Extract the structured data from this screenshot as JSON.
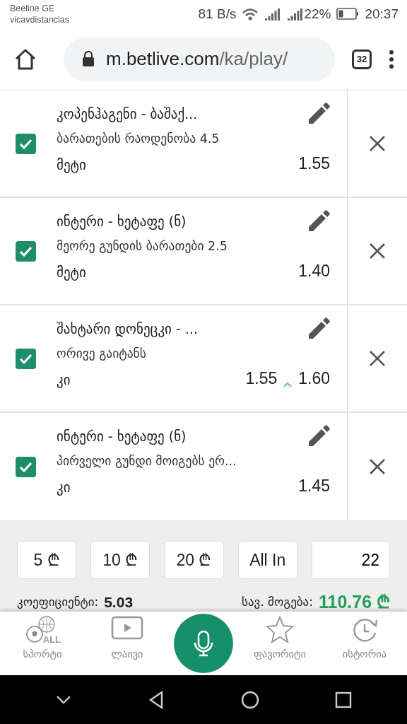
{
  "status_bar": {
    "carrier": "Beeline GE",
    "network_name": "vicavdistancias",
    "speed": "81 B/s",
    "battery": "22%",
    "time": "20:37"
  },
  "browser": {
    "url_host": "m.betlive.com",
    "url_path": "/ka/play/",
    "tab_count": "32"
  },
  "bets": [
    {
      "match": "კოპენჰაგენი - ბაშაქ...",
      "market": "ბარათების რაოდენობა 4.5",
      "selection": "მეტი",
      "odds": "1.55",
      "checked": true
    },
    {
      "match": "ინტერი - ხეტაფე (ნ)",
      "market": "მეორე გუნდის ბარათები 2.5",
      "selection": "მეტი",
      "odds": "1.40",
      "checked": true
    },
    {
      "match": "შახტარი დონეცკი - ...",
      "market": "ორივე გაიტანს",
      "selection": "კი",
      "previous_odds": "1.55",
      "odds_up": true,
      "odds": "1.60",
      "checked": true
    },
    {
      "match": "ინტერი - ხეტაფე (ნ)",
      "market": "პირველი გუნდი მოიგებს ერ...",
      "selection": "კი",
      "odds": "1.45",
      "checked": true
    }
  ],
  "stake_buttons": [
    "5 ₾",
    "10 ₾",
    "20 ₾",
    "All In"
  ],
  "stake_input": {
    "value": "22"
  },
  "summary": {
    "odds_label": "კოეფიციენტი:",
    "odds_value": "5.03",
    "win_label": "სავ. მოგება:",
    "win_value": "110.76 ₾"
  },
  "nav": [
    {
      "kind": "sports",
      "label": "სპორტი",
      "icon_text": "ALL"
    },
    {
      "kind": "live",
      "label": "ლაივი"
    },
    {
      "kind": "mic"
    },
    {
      "kind": "favorites",
      "label": "ფავორიტი"
    },
    {
      "kind": "history",
      "label": "ისტორია"
    }
  ]
}
